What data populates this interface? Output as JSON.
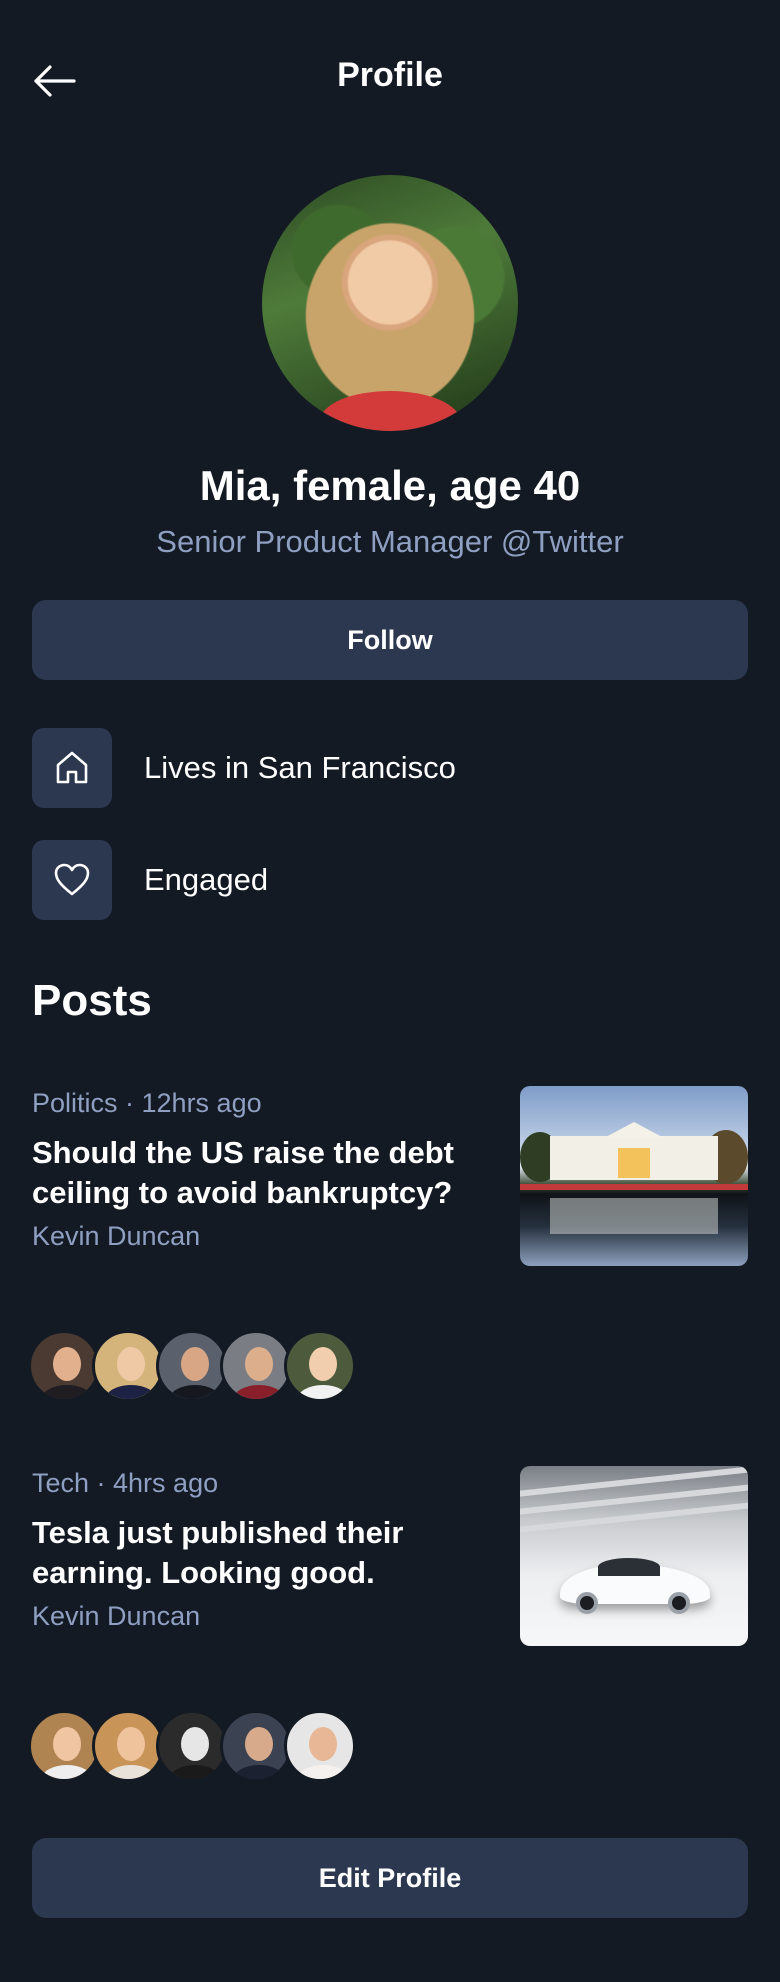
{
  "header": {
    "title": "Profile",
    "back_icon": "arrow-left-icon"
  },
  "profile": {
    "name": "Mia, female, age 40",
    "subtitle": "Senior Product Manager @Twitter",
    "follow_label": "Follow",
    "info": [
      {
        "icon": "home-icon",
        "text": "Lives in San Francisco"
      },
      {
        "icon": "heart-icon",
        "text": "Engaged"
      }
    ]
  },
  "posts": {
    "heading": "Posts",
    "items": [
      {
        "meta": "Politics · 12hrs ago",
        "title": "Should the US raise the debt ceiling to avoid bankruptcy?",
        "author": "Kevin Duncan",
        "thumbnail": "white-house-photo",
        "reactor_count": 5
      },
      {
        "meta": "Tech · 4hrs ago",
        "title": "Tesla just published their earning. Looking good.",
        "author": "Kevin Duncan",
        "thumbnail": "tesla-car-photo",
        "reactor_count": 5
      }
    ]
  },
  "footer": {
    "edit_label": "Edit Profile"
  },
  "colors": {
    "background": "#131a24",
    "surface": "#2b3850",
    "muted_text": "#8f9fc2",
    "text": "#ffffff"
  }
}
